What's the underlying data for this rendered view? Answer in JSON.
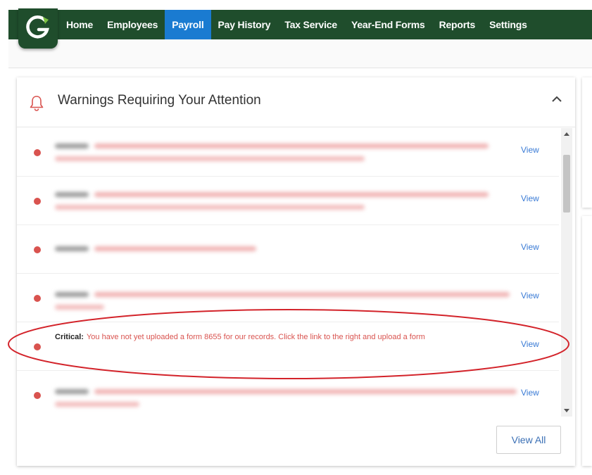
{
  "nav": {
    "items": [
      {
        "label": "Home",
        "active": false
      },
      {
        "label": "Employees",
        "active": false
      },
      {
        "label": "Payroll",
        "active": true
      },
      {
        "label": "Pay History",
        "active": false
      },
      {
        "label": "Tax Service",
        "active": false
      },
      {
        "label": "Year-End Forms",
        "active": false
      },
      {
        "label": "Reports",
        "active": false
      },
      {
        "label": "Settings",
        "active": false
      }
    ],
    "logo_icon": "g-logo-icon",
    "colors": {
      "bar": "#1f4d2c",
      "active": "#1a7bd1"
    }
  },
  "warnings": {
    "title": "Warnings Requiring Your Attention",
    "header_icon": "bell-icon",
    "collapse_icon": "chevron-up-icon",
    "view_label": "View",
    "critical_label": "Critical:",
    "critical_message": "You have not yet uploaded a form 8655 for our records. Click the link to the right and upload a form",
    "view_all_label": "View All",
    "status_color": "#d9534f"
  }
}
